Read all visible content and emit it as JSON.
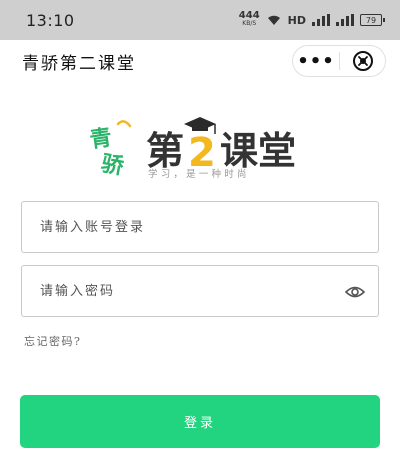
{
  "status_bar": {
    "time": "13:10",
    "net_speed_value": "444",
    "net_speed_unit": "KB/S",
    "hd_label": "HD",
    "battery_level": "79"
  },
  "header": {
    "title": "青骄第二课堂",
    "more_icon": "more-dots-icon",
    "close_icon": "close-circle-icon"
  },
  "logo": {
    "brand_left": "青骄",
    "brand_right_a": "第",
    "brand_right_b": "课堂",
    "slogan": "学习，是一种时尚"
  },
  "form": {
    "account_placeholder": "请输入账号登录",
    "password_placeholder": "请输入密码",
    "eye_icon": "eye-icon",
    "forgot_label": "忘记密码?",
    "login_label": "登录"
  },
  "colors": {
    "accent": "#22d47f",
    "status_bar_bg": "#cfcfcf",
    "logo_green": "#2cb36a",
    "logo_dark": "#333333",
    "logo_gold": "#f2b81d"
  }
}
